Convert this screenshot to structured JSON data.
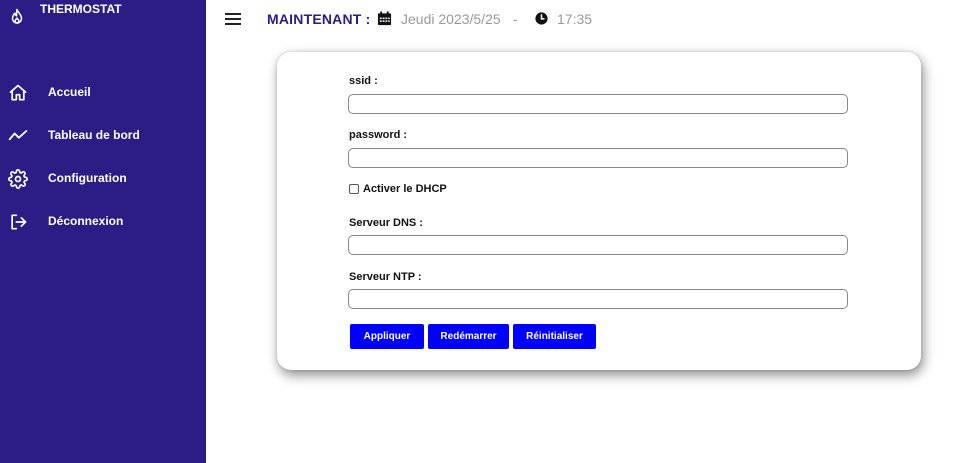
{
  "app": {
    "brand_label": "THERMOSTAT"
  },
  "sidebar": {
    "items": [
      {
        "label": "Accueil",
        "icon": "home-icon"
      },
      {
        "label": "Tableau de bord",
        "icon": "chart-line-icon"
      },
      {
        "label": "Configuration",
        "icon": "gear-icon"
      },
      {
        "label": "Déconnexion",
        "icon": "logout-icon"
      }
    ]
  },
  "header": {
    "now_label": "MAINTENANT :",
    "date": "Jeudi 2023/5/25",
    "separator": "-",
    "time": "17:35"
  },
  "form": {
    "ssid_label": "ssid :",
    "ssid_value": "",
    "password_label": "password :",
    "password_value": "",
    "dhcp_label": "Activer le DHCP",
    "dhcp_checked": false,
    "dns_label": "Serveur DNS :",
    "dns_value": "",
    "ntp_label": "Serveur NTP :",
    "ntp_value": "",
    "buttons": {
      "apply": "Appliquer",
      "restart": "Redémarrer",
      "reset": "Réinitialiser"
    }
  },
  "colors": {
    "sidebar_bg": "#2c1d86",
    "button_bg": "#0000ff",
    "header_accent": "#2c1d86",
    "muted_text": "#9a9a9a"
  }
}
